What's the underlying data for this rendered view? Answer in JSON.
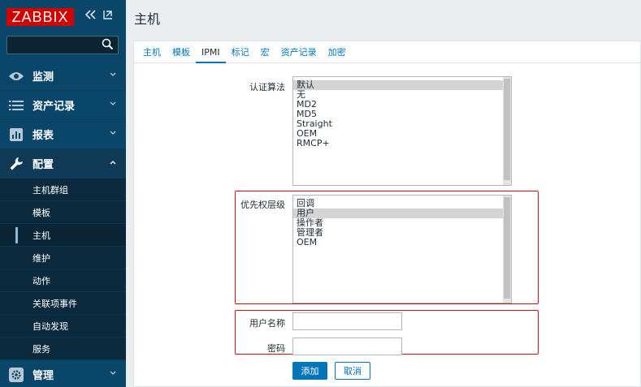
{
  "app": {
    "logo": "ZABBIX",
    "page_title": "主机"
  },
  "colors": {
    "sidebar": "#0a466a",
    "accent": "#0275b8",
    "logo_red": "#d40000",
    "highlight_border": "#d20f0f"
  },
  "sidebar": {
    "search_placeholder": "",
    "menu": [
      {
        "label": "监测",
        "icon": "eye-icon"
      },
      {
        "label": "资产记录",
        "icon": "list-icon"
      },
      {
        "label": "报表",
        "icon": "bar-chart-icon"
      },
      {
        "label": "配置",
        "icon": "wrench-icon"
      },
      {
        "label": "管理",
        "icon": "gear-icon"
      }
    ],
    "submenu": [
      "主机群组",
      "模板",
      "主机",
      "维护",
      "动作",
      "关联项事件",
      "自动发现",
      "服务"
    ]
  },
  "tabs": [
    "主机",
    "模板",
    "IPMI",
    "标记",
    "宏",
    "资产记录",
    "加密"
  ],
  "form": {
    "auth_label": "认证算法",
    "auth_options": [
      "默认",
      "无",
      "MD2",
      "MD5",
      "Straight",
      "OEM",
      "RMCP+"
    ],
    "privilege_label": "优先权层级",
    "privilege_options": [
      "回调",
      "用户",
      "操作者",
      "管理者",
      "OEM"
    ],
    "username_label": "用户名称",
    "username_value": "",
    "password_label": "密码",
    "password_value": "",
    "add_button": "添加",
    "cancel_button": "取消"
  }
}
